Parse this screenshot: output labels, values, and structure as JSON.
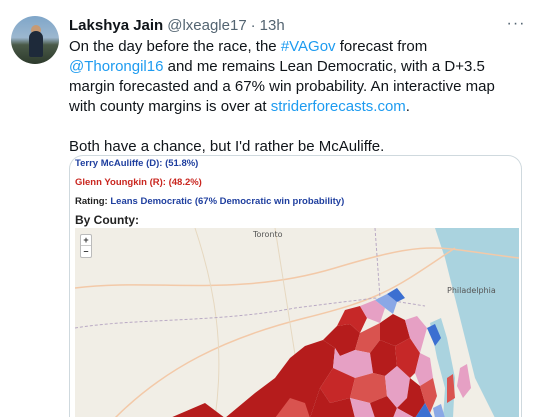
{
  "author": {
    "name": "Lakshya Jain",
    "handle": "@lxeagle17",
    "separator": "·",
    "time": "13h"
  },
  "tweet": {
    "line1_pre": "On the day before the race, the ",
    "hashtag": "#VAGov",
    "line1_mid": " forecast from ",
    "mention": "@Thorongil16",
    "line1_post": " and me remains Lean Democratic, with a D+3.5 margin forecasted and a 67% win probability. An interactive map with county margins is over at ",
    "url": "striderforecasts.com",
    "line1_end": ".",
    "line2": "Both have a chance, but I'd rather be McAuliffe."
  },
  "media": {
    "dem_line": "Terry McAuliffe (D): (51.8%)",
    "rep_line": "Glenn Youngkin (R): (48.2%)",
    "rating_label": "Rating: ",
    "rating_value": "Leans Democratic (67% Democratic win probability)",
    "by_county": "By County:",
    "zoom_in": "+",
    "zoom_out": "–",
    "cities": {
      "philadelphia": "Philadelphia",
      "toronto": "Toronto"
    }
  },
  "more_icon": "···",
  "colors": {
    "accent": "#1d9bf0",
    "dem": "#1f3f9f",
    "rep": "#c9261f",
    "solid_r": "#b51c1c",
    "likely_r": "#d9534f",
    "lean_d": "#e6a0c4",
    "likely_d": "#8aa8e6",
    "solid_d": "#3b6fd1"
  }
}
